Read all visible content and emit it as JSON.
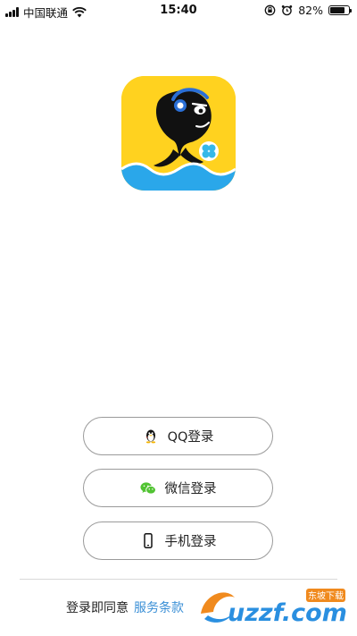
{
  "status_bar": {
    "carrier": "中国联通",
    "time": "15:40",
    "battery_percent": "82%",
    "battery_level": 0.82,
    "icons": [
      "signal-icon",
      "wifi-icon",
      "rotation-lock-icon",
      "alarm-icon",
      "battery-icon"
    ]
  },
  "logo": {
    "icon": "fish-mascot-logo",
    "background_color": "#ffd21f",
    "wave_color": "#2aa7ea"
  },
  "login": {
    "qq_label": "QQ登录",
    "wechat_label": "微信登录",
    "phone_label": "手机登录"
  },
  "agreement": {
    "prefix": "登录即同意",
    "link": "服务条款"
  },
  "watermark": {
    "text": "uzzf.com",
    "badge": "东坡下载"
  }
}
